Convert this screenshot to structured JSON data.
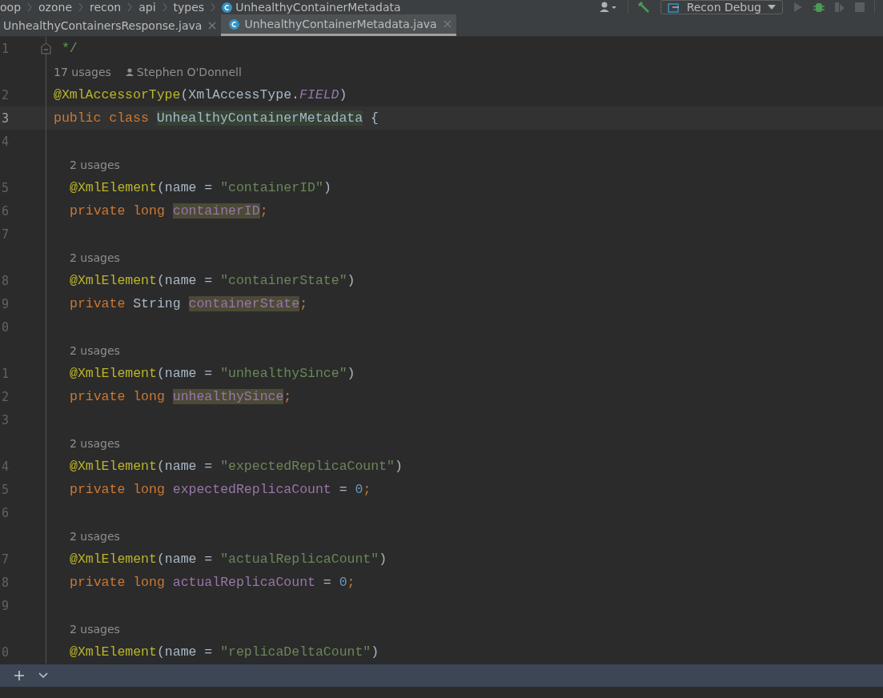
{
  "breadcrumbs": [
    {
      "label": "oop"
    },
    {
      "label": "ozone"
    },
    {
      "label": "recon"
    },
    {
      "label": "api"
    },
    {
      "label": "types"
    },
    {
      "label": "UnhealthyContainerMetadata",
      "kind": "class"
    }
  ],
  "run_config": {
    "label": "Recon Debug"
  },
  "tabs": [
    {
      "label": "UnhealthyContainersResponse.java",
      "selected": false,
      "kind": "plain"
    },
    {
      "label": "UnhealthyContainerMetadata.java",
      "selected": true,
      "kind": "class"
    }
  ],
  "lines": [
    {
      "kind": "code",
      "number": "1",
      "indented": false,
      "current": false,
      "fold": true,
      "tokens": [
        {
          "kind": "comment",
          "text": " */"
        }
      ]
    },
    {
      "kind": "usages",
      "indented": false,
      "text": "17 usages",
      "author": "Stephen O'Donnell"
    },
    {
      "kind": "code",
      "number": "2",
      "indented": false,
      "current": false,
      "tokens": [
        {
          "kind": "annotation",
          "text": "@XmlAccessorType"
        },
        {
          "kind": "plain",
          "text": "(XmlAccessType."
        },
        {
          "kind": "const",
          "text": "FIELD"
        },
        {
          "kind": "plain",
          "text": ")"
        }
      ]
    },
    {
      "kind": "code",
      "number": "3",
      "indented": false,
      "current": true,
      "tokens": [
        {
          "kind": "keyword",
          "text": "public class "
        },
        {
          "kind": "decl",
          "text": "UnhealthyContainerMetadata"
        },
        {
          "kind": "plain",
          "text": " {"
        }
      ]
    },
    {
      "kind": "code",
      "number": "4",
      "current": false
    },
    {
      "kind": "usages",
      "indented": true,
      "text": "2 usages"
    },
    {
      "kind": "code",
      "number": "5",
      "indented": true,
      "current": false,
      "tokens": [
        {
          "kind": "annotation",
          "text": "@XmlElement"
        },
        {
          "kind": "plain",
          "text": "(name = "
        },
        {
          "kind": "string",
          "text": "\"containerID\""
        },
        {
          "kind": "plain",
          "text": ")"
        }
      ]
    },
    {
      "kind": "code",
      "number": "6",
      "indented": true,
      "current": false,
      "tokens": [
        {
          "kind": "keyword",
          "text": "private long "
        },
        {
          "kind": "usage",
          "text": "containerID"
        },
        {
          "kind": "keyword",
          "text": ";"
        }
      ]
    },
    {
      "kind": "code",
      "number": "7",
      "current": false
    },
    {
      "kind": "usages",
      "indented": true,
      "text": "2 usages"
    },
    {
      "kind": "code",
      "number": "8",
      "indented": true,
      "current": false,
      "tokens": [
        {
          "kind": "annotation",
          "text": "@XmlElement"
        },
        {
          "kind": "plain",
          "text": "(name = "
        },
        {
          "kind": "string",
          "text": "\"containerState\""
        },
        {
          "kind": "plain",
          "text": ")"
        }
      ]
    },
    {
      "kind": "code",
      "number": "9",
      "indented": true,
      "current": false,
      "tokens": [
        {
          "kind": "keyword",
          "text": "private "
        },
        {
          "kind": "plain",
          "text": "String "
        },
        {
          "kind": "usage",
          "text": "containerState"
        },
        {
          "kind": "keyword",
          "text": ";"
        }
      ]
    },
    {
      "kind": "code",
      "number": "0",
      "current": false
    },
    {
      "kind": "usages",
      "indented": true,
      "text": "2 usages"
    },
    {
      "kind": "code",
      "number": "1",
      "indented": true,
      "current": false,
      "tokens": [
        {
          "kind": "annotation",
          "text": "@XmlElement"
        },
        {
          "kind": "plain",
          "text": "(name = "
        },
        {
          "kind": "string",
          "text": "\"unhealthySince\""
        },
        {
          "kind": "plain",
          "text": ")"
        }
      ]
    },
    {
      "kind": "code",
      "number": "2",
      "indented": true,
      "current": false,
      "tokens": [
        {
          "kind": "keyword",
          "text": "private long "
        },
        {
          "kind": "usage",
          "text": "unhealthySince"
        },
        {
          "kind": "keyword",
          "text": ";"
        }
      ]
    },
    {
      "kind": "code",
      "number": "3",
      "current": false
    },
    {
      "kind": "usages",
      "indented": true,
      "text": "2 usages"
    },
    {
      "kind": "code",
      "number": "4",
      "indented": true,
      "current": false,
      "tokens": [
        {
          "kind": "annotation",
          "text": "@XmlElement"
        },
        {
          "kind": "plain",
          "text": "(name = "
        },
        {
          "kind": "string",
          "text": "\"expectedReplicaCount\""
        },
        {
          "kind": "plain",
          "text": ")"
        }
      ]
    },
    {
      "kind": "code",
      "number": "5",
      "indented": true,
      "current": false,
      "tokens": [
        {
          "kind": "keyword",
          "text": "private long "
        },
        {
          "kind": "field",
          "text": "expectedReplicaCount"
        },
        {
          "kind": "plain",
          "text": " = "
        },
        {
          "kind": "number",
          "text": "0"
        },
        {
          "kind": "keyword",
          "text": ";"
        }
      ]
    },
    {
      "kind": "code",
      "number": "6",
      "current": false
    },
    {
      "kind": "usages",
      "indented": true,
      "text": "2 usages"
    },
    {
      "kind": "code",
      "number": "7",
      "indented": true,
      "current": false,
      "tokens": [
        {
          "kind": "annotation",
          "text": "@XmlElement"
        },
        {
          "kind": "plain",
          "text": "(name = "
        },
        {
          "kind": "string",
          "text": "\"actualReplicaCount\""
        },
        {
          "kind": "plain",
          "text": ")"
        }
      ]
    },
    {
      "kind": "code",
      "number": "8",
      "indented": true,
      "current": false,
      "tokens": [
        {
          "kind": "keyword",
          "text": "private long "
        },
        {
          "kind": "field",
          "text": "actualReplicaCount"
        },
        {
          "kind": "plain",
          "text": " = "
        },
        {
          "kind": "number",
          "text": "0"
        },
        {
          "kind": "keyword",
          "text": ";"
        }
      ]
    },
    {
      "kind": "code",
      "number": "9",
      "current": false
    },
    {
      "kind": "usages",
      "indented": true,
      "text": "2 usages"
    },
    {
      "kind": "code",
      "number": "0",
      "indented": true,
      "current": false,
      "tokens": [
        {
          "kind": "annotation",
          "text": "@XmlElement"
        },
        {
          "kind": "plain",
          "text": "(name = "
        },
        {
          "kind": "string",
          "text": "\"replicaDeltaCount\""
        },
        {
          "kind": "plain",
          "text": ")"
        }
      ]
    }
  ]
}
